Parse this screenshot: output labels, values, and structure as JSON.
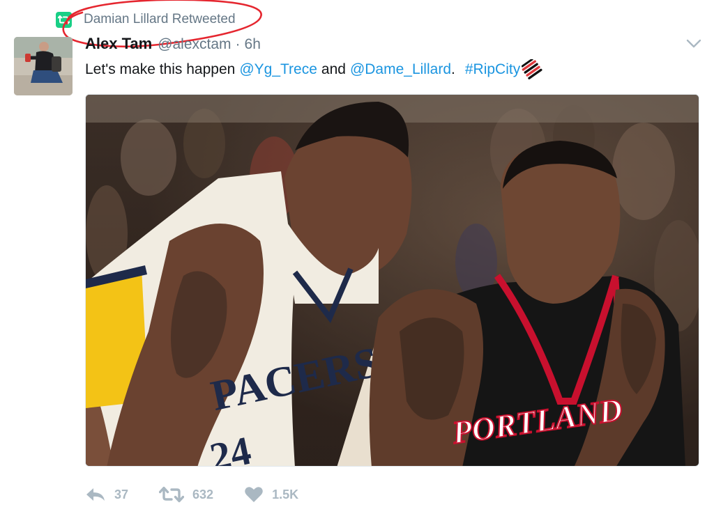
{
  "retweet_context": {
    "text": "Damian Lillard Retweeted",
    "icon": "retweet-badge-icon",
    "badge_color": "#19cf86",
    "annotation_color": "#e5262f"
  },
  "tweet": {
    "author": {
      "display_name": "Alex Tam",
      "handle": "@alexctam"
    },
    "separator": "·",
    "timestamp": "6h",
    "text": {
      "lead": "Let's make this happen",
      "mention_1": "@Yg_Trece",
      "and": "and",
      "mention_2": "@Dame_Lillard",
      "period": ".",
      "hashtag": "#RipCity"
    },
    "media": {
      "jerseys": [
        "PACERS",
        "PORTLAND"
      ],
      "number": "24"
    },
    "actions": {
      "reply": {
        "icon": "reply-icon",
        "count": "37"
      },
      "retweet": {
        "icon": "retweet-icon",
        "count": "632"
      },
      "like": {
        "icon": "heart-icon",
        "count": "1.5K"
      }
    },
    "colors": {
      "link": "#1b95e0",
      "secondary": "#657786",
      "action": "#aab8c2"
    }
  }
}
